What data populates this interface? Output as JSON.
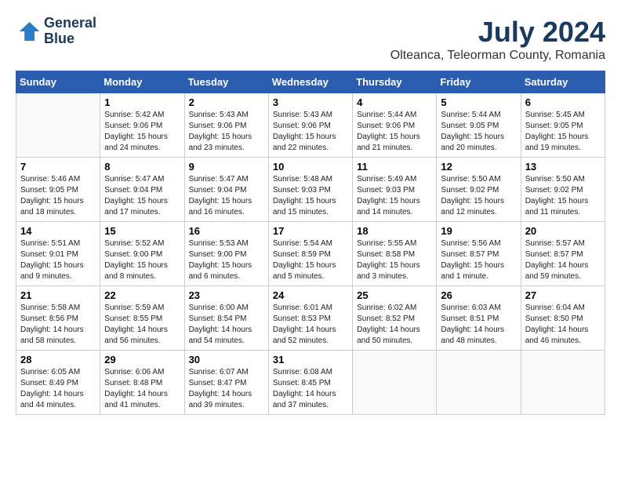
{
  "header": {
    "logo_line1": "General",
    "logo_line2": "Blue",
    "month_year": "July 2024",
    "location": "Olteanca, Teleorman County, Romania"
  },
  "days_of_week": [
    "Sunday",
    "Monday",
    "Tuesday",
    "Wednesday",
    "Thursday",
    "Friday",
    "Saturday"
  ],
  "weeks": [
    [
      {
        "num": "",
        "info": ""
      },
      {
        "num": "1",
        "info": "Sunrise: 5:42 AM\nSunset: 9:06 PM\nDaylight: 15 hours\nand 24 minutes."
      },
      {
        "num": "2",
        "info": "Sunrise: 5:43 AM\nSunset: 9:06 PM\nDaylight: 15 hours\nand 23 minutes."
      },
      {
        "num": "3",
        "info": "Sunrise: 5:43 AM\nSunset: 9:06 PM\nDaylight: 15 hours\nand 22 minutes."
      },
      {
        "num": "4",
        "info": "Sunrise: 5:44 AM\nSunset: 9:06 PM\nDaylight: 15 hours\nand 21 minutes."
      },
      {
        "num": "5",
        "info": "Sunrise: 5:44 AM\nSunset: 9:05 PM\nDaylight: 15 hours\nand 20 minutes."
      },
      {
        "num": "6",
        "info": "Sunrise: 5:45 AM\nSunset: 9:05 PM\nDaylight: 15 hours\nand 19 minutes."
      }
    ],
    [
      {
        "num": "7",
        "info": "Sunrise: 5:46 AM\nSunset: 9:05 PM\nDaylight: 15 hours\nand 18 minutes."
      },
      {
        "num": "8",
        "info": "Sunrise: 5:47 AM\nSunset: 9:04 PM\nDaylight: 15 hours\nand 17 minutes."
      },
      {
        "num": "9",
        "info": "Sunrise: 5:47 AM\nSunset: 9:04 PM\nDaylight: 15 hours\nand 16 minutes."
      },
      {
        "num": "10",
        "info": "Sunrise: 5:48 AM\nSunset: 9:03 PM\nDaylight: 15 hours\nand 15 minutes."
      },
      {
        "num": "11",
        "info": "Sunrise: 5:49 AM\nSunset: 9:03 PM\nDaylight: 15 hours\nand 14 minutes."
      },
      {
        "num": "12",
        "info": "Sunrise: 5:50 AM\nSunset: 9:02 PM\nDaylight: 15 hours\nand 12 minutes."
      },
      {
        "num": "13",
        "info": "Sunrise: 5:50 AM\nSunset: 9:02 PM\nDaylight: 15 hours\nand 11 minutes."
      }
    ],
    [
      {
        "num": "14",
        "info": "Sunrise: 5:51 AM\nSunset: 9:01 PM\nDaylight: 15 hours\nand 9 minutes."
      },
      {
        "num": "15",
        "info": "Sunrise: 5:52 AM\nSunset: 9:00 PM\nDaylight: 15 hours\nand 8 minutes."
      },
      {
        "num": "16",
        "info": "Sunrise: 5:53 AM\nSunset: 9:00 PM\nDaylight: 15 hours\nand 6 minutes."
      },
      {
        "num": "17",
        "info": "Sunrise: 5:54 AM\nSunset: 8:59 PM\nDaylight: 15 hours\nand 5 minutes."
      },
      {
        "num": "18",
        "info": "Sunrise: 5:55 AM\nSunset: 8:58 PM\nDaylight: 15 hours\nand 3 minutes."
      },
      {
        "num": "19",
        "info": "Sunrise: 5:56 AM\nSunset: 8:57 PM\nDaylight: 15 hours\nand 1 minute."
      },
      {
        "num": "20",
        "info": "Sunrise: 5:57 AM\nSunset: 8:57 PM\nDaylight: 14 hours\nand 59 minutes."
      }
    ],
    [
      {
        "num": "21",
        "info": "Sunrise: 5:58 AM\nSunset: 8:56 PM\nDaylight: 14 hours\nand 58 minutes."
      },
      {
        "num": "22",
        "info": "Sunrise: 5:59 AM\nSunset: 8:55 PM\nDaylight: 14 hours\nand 56 minutes."
      },
      {
        "num": "23",
        "info": "Sunrise: 6:00 AM\nSunset: 8:54 PM\nDaylight: 14 hours\nand 54 minutes."
      },
      {
        "num": "24",
        "info": "Sunrise: 6:01 AM\nSunset: 8:53 PM\nDaylight: 14 hours\nand 52 minutes."
      },
      {
        "num": "25",
        "info": "Sunrise: 6:02 AM\nSunset: 8:52 PM\nDaylight: 14 hours\nand 50 minutes."
      },
      {
        "num": "26",
        "info": "Sunrise: 6:03 AM\nSunset: 8:51 PM\nDaylight: 14 hours\nand 48 minutes."
      },
      {
        "num": "27",
        "info": "Sunrise: 6:04 AM\nSunset: 8:50 PM\nDaylight: 14 hours\nand 46 minutes."
      }
    ],
    [
      {
        "num": "28",
        "info": "Sunrise: 6:05 AM\nSunset: 8:49 PM\nDaylight: 14 hours\nand 44 minutes."
      },
      {
        "num": "29",
        "info": "Sunrise: 6:06 AM\nSunset: 8:48 PM\nDaylight: 14 hours\nand 41 minutes."
      },
      {
        "num": "30",
        "info": "Sunrise: 6:07 AM\nSunset: 8:47 PM\nDaylight: 14 hours\nand 39 minutes."
      },
      {
        "num": "31",
        "info": "Sunrise: 6:08 AM\nSunset: 8:45 PM\nDaylight: 14 hours\nand 37 minutes."
      },
      {
        "num": "",
        "info": ""
      },
      {
        "num": "",
        "info": ""
      },
      {
        "num": "",
        "info": ""
      }
    ]
  ]
}
